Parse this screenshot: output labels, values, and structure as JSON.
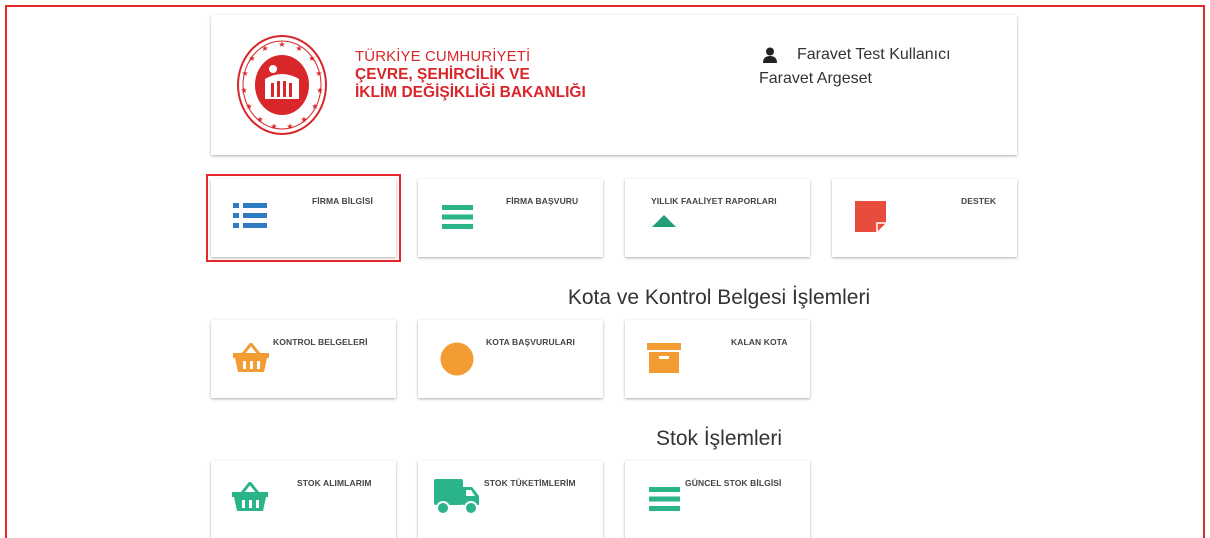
{
  "header": {
    "ministry_line1": "TÜRKİYE CUMHURİYETİ",
    "ministry_line2": "ÇEVRE, ŞEHİRCİLİK VE",
    "ministry_line3": "İKLİM DEĞİŞİKLİĞİ BAKANLIĞI",
    "user_name": "Faravet Test Kullanıcı",
    "company": "Faravet Argeset"
  },
  "top_cards": [
    {
      "label": "FİRMA BİLGİSİ",
      "icon": "list-icon",
      "color": "#2e7bc4"
    },
    {
      "label": "FİRMA BAŞVURU",
      "icon": "menu-icon",
      "color": "#2bb38a"
    },
    {
      "label": "YILLIK FAALİYET RAPORLARI",
      "icon": "triangle-up-icon",
      "color": "#2bb38a"
    },
    {
      "label": "DESTEK",
      "icon": "note-icon",
      "color": "#e84c3d"
    }
  ],
  "section_kota": {
    "title": "Kota ve Kontrol Belgesi İşlemleri",
    "cards": [
      {
        "label": "KONTROL BELGELERİ",
        "icon": "basket-icon",
        "color": "#f39c33"
      },
      {
        "label": "KOTA BAŞVURULARI",
        "icon": "circle-icon",
        "color": "#f39c33"
      },
      {
        "label": "KALAN KOTA",
        "icon": "archive-icon",
        "color": "#f39c33"
      }
    ]
  },
  "section_stok": {
    "title": "Stok İşlemleri",
    "cards": [
      {
        "label": "STOK ALIMLARIM",
        "icon": "basket-icon",
        "color": "#2bb38a"
      },
      {
        "label": "STOK TÜKETİMLERİM",
        "icon": "truck-icon",
        "color": "#2bb38a"
      },
      {
        "label": "GÜNCEL STOK BİLGİSİ",
        "icon": "menu-icon",
        "color": "#2bb38a"
      }
    ]
  },
  "colors": {
    "accent_red": "#e5262a",
    "brand_red": "#d9262b",
    "blue": "#2e7bc4",
    "green": "#2bb38a",
    "orange": "#f39c33"
  }
}
